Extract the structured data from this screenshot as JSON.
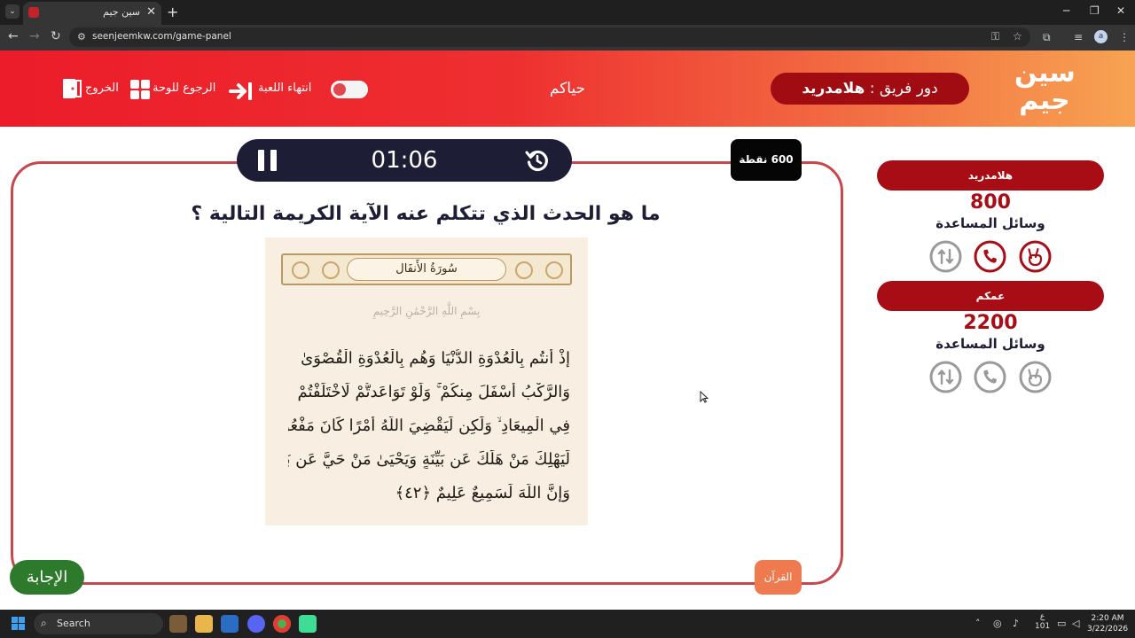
{
  "browser": {
    "tab_title": "سين جيم",
    "tab_close": "✕",
    "new_tab": "+",
    "url": "seenjeemkw.com/game-panel",
    "profile_initial": "a"
  },
  "header": {
    "logo_line1": "سين",
    "logo_line2": "جيم",
    "turn_prefix": "دور فريق : ",
    "turn_team": "هلامدريد",
    "center_title": "حياكم",
    "end_game_label": "انتهاء اللعبة",
    "back_to_board_label": "الرجوع للوحة",
    "exit_label": "الخروج"
  },
  "game": {
    "timer": "01:06",
    "points": "600 نقطة",
    "question": "ما هو الحدث الذي تتكلم عنه الآية الكريمة التالية ؟",
    "answer_button": "الإجابة",
    "category_button": "القرآن"
  },
  "quran_image": {
    "sura_name": "سُورَةُ الأَنفَال",
    "basmala": "بِسْمِ اللَّهِ الرَّحْمَٰنِ الرَّحِيمِ",
    "lines": [
      "إِذْ أَنتُم بِالْعُدْوَةِ الدُّنْيَا وَهُم بِالْعُدْوَةِ الْقُصْوَىٰ",
      "وَالرَّكْبُ أَسْفَلَ مِنكُمْ ۚ وَلَوْ تَوَاعَدتُّمْ لَاخْتَلَفْتُمْ",
      "فِي الْمِيعَادِ ۙ وَلَٰكِن لِّيَقْضِيَ اللَّهُ أَمْرًا كَانَ مَفْعُولًا",
      "لِّيَهْلِكَ مَنْ هَلَكَ عَن بَيِّنَةٍ وَيَحْيَىٰ مَنْ حَيَّ عَن بَيِّنَةٍ ۗ",
      "وَإِنَّ اللَّهَ لَسَمِيعٌ عَلِيمٌ ﴿٤٢﴾"
    ]
  },
  "teams": [
    {
      "name": "هلامدريد",
      "score": "800",
      "aids_label": "وسائل المساعدة",
      "aids": [
        {
          "icon": "peace-hand-icon",
          "active": true
        },
        {
          "icon": "phone-icon",
          "active": true
        },
        {
          "icon": "switch-icon",
          "active": false
        }
      ]
    },
    {
      "name": "عمكم",
      "score": "2200",
      "aids_label": "وسائل المساعدة",
      "aids": [
        {
          "icon": "peace-hand-icon",
          "active": false
        },
        {
          "icon": "phone-icon",
          "active": false
        },
        {
          "icon": "switch-icon",
          "active": false
        }
      ]
    }
  ],
  "taskbar": {
    "search_placeholder": "Search",
    "time": "2:20 AM",
    "date": "3/22/2026",
    "ime": "ع",
    "ime_sub": "101"
  },
  "colors": {
    "header_red": "#ec1c2a",
    "header_orange": "#f7a352",
    "team_red": "#a80d15",
    "board_border": "#c8474d",
    "timer_bg": "#1d1d35",
    "answer_green": "#2e7a2c",
    "category_orange": "#f07a4f"
  }
}
